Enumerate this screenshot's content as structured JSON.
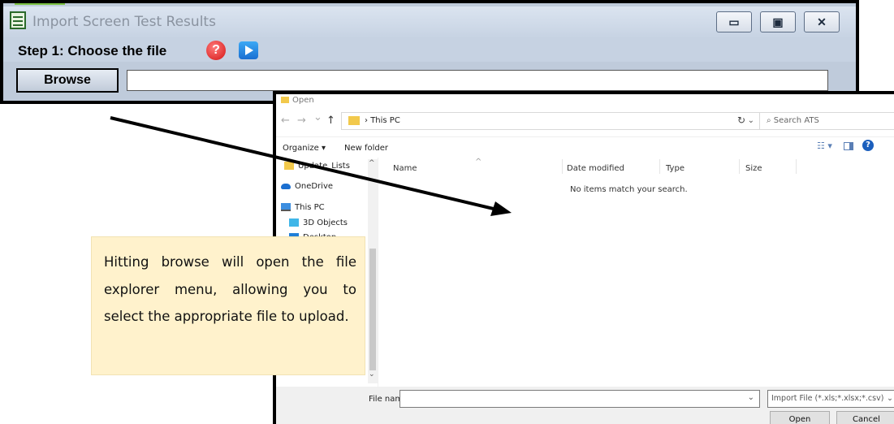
{
  "import_window": {
    "title": "Import Screen Test Results",
    "minimize_glyph": "▭",
    "maximize_glyph": "▣",
    "close_glyph": "✕",
    "step_label": "Step 1: Choose the file",
    "help_glyph": "?",
    "browse_label": "Browse",
    "file_path_value": ""
  },
  "open_dialog": {
    "title": "Open",
    "back_glyph": "←",
    "forward_glyph": "→",
    "recent_glyph": "⌄",
    "up_glyph": "↑",
    "breadcrumb_sep": "›",
    "address": "This PC",
    "address_chevron": "⌄",
    "refresh_glyph": "↻",
    "search_placeholder": "⌕  Search ATS",
    "organize_label": "Organize ▾",
    "new_folder_label": "New folder",
    "view_glyph": "☷ ▾",
    "help_glyph": "?",
    "sidebar": {
      "items": [
        {
          "label": "Update_Lists",
          "icon": "folder-icon",
          "color": "#f2c94c"
        },
        {
          "label": "OneDrive",
          "icon": "cloud-icon",
          "color": "#1b6fd0"
        },
        {
          "label": "This PC",
          "icon": "computer-icon",
          "color": "#3c8ee0"
        },
        {
          "label": "3D Objects",
          "icon": "cube-icon",
          "color": "#3fb6e8"
        },
        {
          "label": "Desktop",
          "icon": "desktop-icon",
          "color": "#1f7fd8"
        }
      ],
      "scroll_up_glyph": "^",
      "scroll_down_glyph": "⌄"
    },
    "columns": [
      "Name",
      "Date modified",
      "Type",
      "Size"
    ],
    "sort_glyph": "^",
    "empty_message": "No items match your search.",
    "file_name_label": "File name:",
    "file_name_value": "",
    "file_name_chevron": "⌄",
    "filter_label": "Import File (*.xls;*.xlsx;*.csv)",
    "filter_chevron": "⌄",
    "open_label": "Open",
    "cancel_label": "Cancel"
  },
  "callout": {
    "text": "Hitting browse will open the file explorer menu, allowing you to select the appropriate file to upload."
  },
  "colors": {
    "window_border": "#000000",
    "callout_bg": "#fff2cc",
    "titlebar": "#c7d3e3",
    "accent_green": "#7cc243"
  }
}
